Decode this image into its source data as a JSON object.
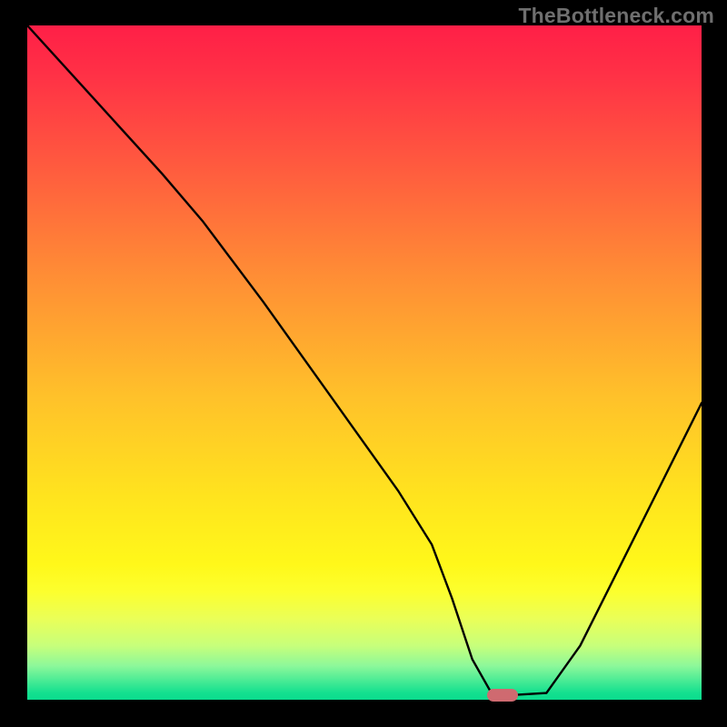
{
  "watermark": "TheBottleneck.com",
  "colors": {
    "background": "#000000",
    "watermark_text": "#6f6f6f",
    "curve": "#000000",
    "marker": "#cf6a70",
    "gradient_top": "#ff1f47",
    "gradient_bottom": "#0bdc8d"
  },
  "chart_data": {
    "type": "line",
    "title": "",
    "xlabel": "",
    "ylabel": "",
    "xlim": [
      0,
      100
    ],
    "ylim": [
      0,
      100
    ],
    "grid": false,
    "legend": false,
    "series": [
      {
        "name": "curve",
        "x": [
          0,
          10,
          20,
          26,
          35,
          45,
          55,
          60,
          63,
          66,
          69,
          72,
          77,
          82,
          88,
          94,
          100
        ],
        "values": [
          100,
          89,
          78,
          71,
          59,
          45,
          31,
          23,
          15,
          6,
          0.7,
          0.7,
          1.0,
          8,
          20,
          32,
          44
        ]
      }
    ],
    "marker": {
      "x": 70.5,
      "y": 0.7
    },
    "notes": "y-axis shown inverted visually (0 at bottom maps to green band); background is a vertical heat gradient from red (top) to green (bottom); values estimated from pixel positions"
  }
}
